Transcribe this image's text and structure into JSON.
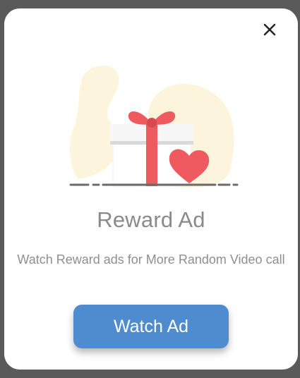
{
  "dialog": {
    "title": "Reward Ad",
    "message": "Watch Reward ads for More Random Video call",
    "watch_button_label": "Watch Ad",
    "close_icon": "close-icon",
    "illustration_icon": "gift-heart-icon"
  },
  "colors": {
    "accent": "#4f8ccf",
    "gift_ribbon": "#ef5a5f",
    "blob": "#fdf4dc",
    "text_gray": "#8a8a8a"
  }
}
